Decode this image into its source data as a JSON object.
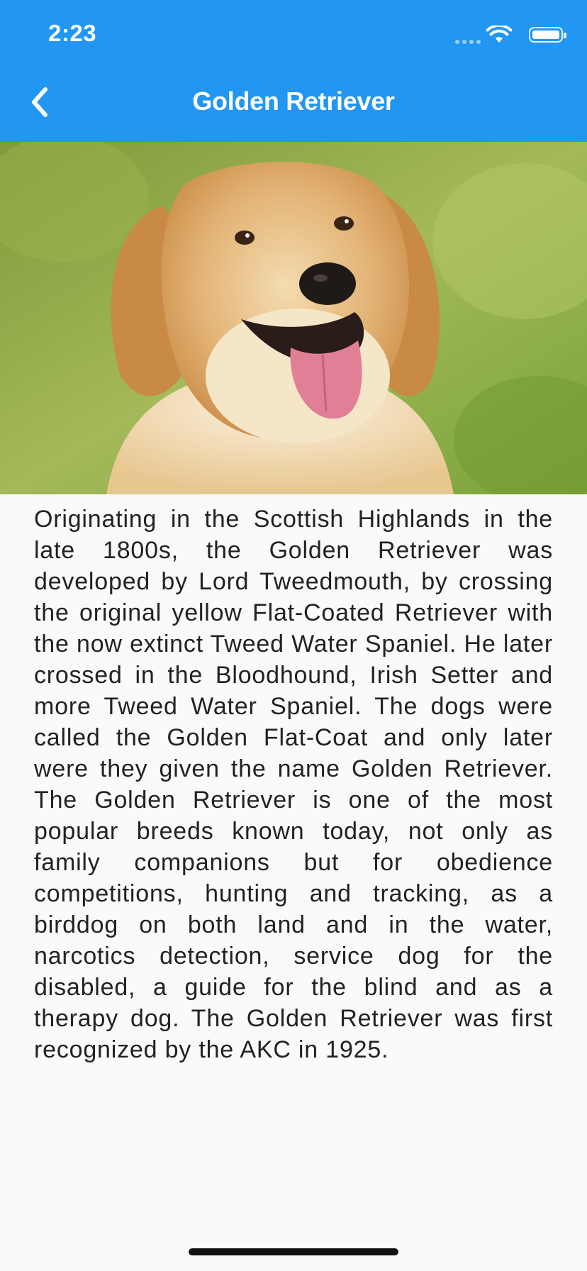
{
  "status_bar": {
    "time": "2:23"
  },
  "app_bar": {
    "title": "Golden Retriever",
    "background": "#2196f3"
  },
  "hero_image": {
    "subject": "golden retriever dog portrait on green background"
  },
  "content": {
    "description": "Originating in the Scottish Highlands in the late 1800s, the Golden Retriever was developed by Lord Tweedmouth, by crossing the original yellow Flat-Coated Retriever with the now extinct Tweed Water Spaniel. He later crossed in the Bloodhound, Irish Setter and more Tweed Water Spaniel. The dogs were called the Golden Flat-Coat and only later were they given the name Golden Retriever. The Golden Retriever is one of the most popular breeds known today, not only as family companions but for obedience competitions, hunting and tracking, as a birddog on both land and in the water, narcotics detection, service dog for the disabled, a guide for the blind and as a therapy dog. The Golden Retriever was first recognized by the AKC in 1925."
  },
  "icons": {
    "back": "chevron-left-icon",
    "wifi": "wifi-icon",
    "battery": "battery-icon",
    "signal": "cellular-signal-icon"
  }
}
